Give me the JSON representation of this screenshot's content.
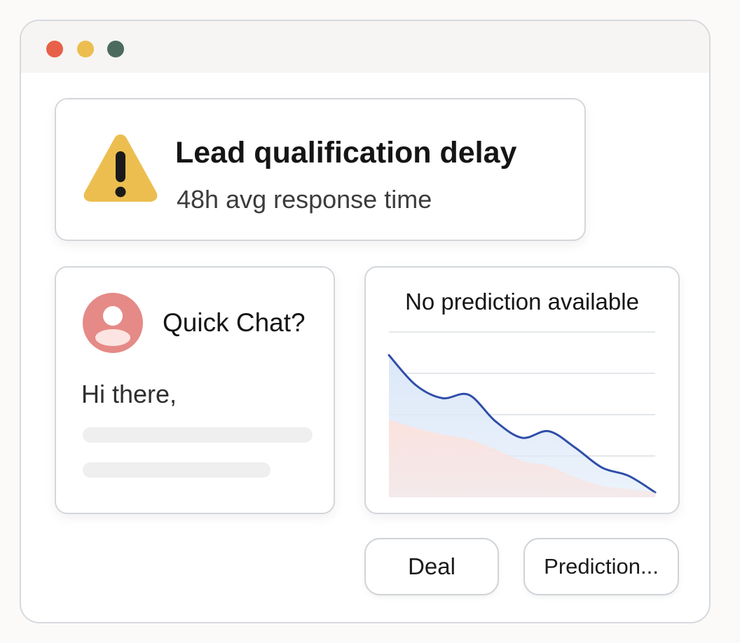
{
  "window": {
    "controls": [
      "close",
      "minimize",
      "maximize"
    ]
  },
  "alert": {
    "icon": "warning-icon",
    "title": "Lead qualification delay",
    "subtitle": "48h avg response time",
    "icon_color": "#ECBE50"
  },
  "chat": {
    "avatar_icon": "user-avatar-icon",
    "title": "Quick Chat?",
    "message": "Hi there,",
    "avatar_color": "#E58A86"
  },
  "chart_data": {
    "type": "area",
    "title": "No prediction available",
    "xlabel": "",
    "ylabel": "",
    "grid": true,
    "legend": "none",
    "x": [
      0,
      1,
      2,
      3,
      4,
      5,
      6,
      7,
      8,
      9,
      10
    ],
    "series": [
      {
        "color": "#2F4EA8",
        "fill": "#DCE8F8",
        "values": [
          0.86,
          0.68,
          0.6,
          0.62,
          0.46,
          0.36,
          0.4,
          0.3,
          0.18,
          0.13,
          0.03
        ]
      },
      {
        "color": "#F6D3CC",
        "fill": "#FBE3DE",
        "values": [
          0.47,
          0.42,
          0.38,
          0.35,
          0.29,
          0.22,
          0.19,
          0.12,
          0.07,
          0.05,
          0.03
        ]
      }
    ],
    "ylim": [
      0,
      1
    ]
  },
  "buttons": {
    "deal_label": "Deal",
    "prediction_label": "Prediction..."
  },
  "colors": {
    "accent_line": "#2F4EA8",
    "warning": "#ECBE50",
    "close": "#E8604A",
    "minimize": "#ECBE50",
    "maximize": "#4D6A5E"
  }
}
